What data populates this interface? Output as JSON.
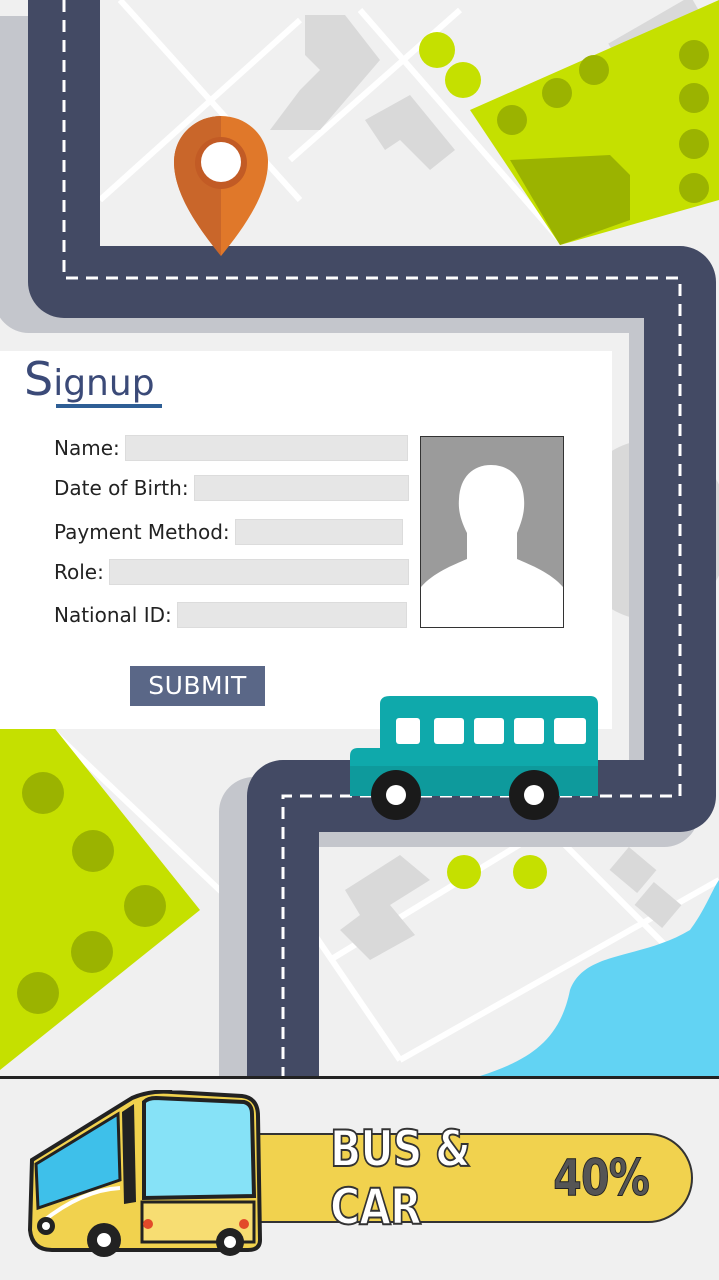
{
  "signup": {
    "title_first": "S",
    "title_rest": "ignup",
    "fields": [
      {
        "label": "Name:",
        "value": ""
      },
      {
        "label": "Date of Birth:",
        "value": ""
      },
      {
        "label": "Payment Method:",
        "value": ""
      },
      {
        "label": "Role:",
        "value": ""
      },
      {
        "label": "National ID:",
        "value": ""
      }
    ],
    "submit_label": "SUBMIT"
  },
  "promo": {
    "text": "BUS & CAR",
    "percent": "40%"
  },
  "colors": {
    "road": "#434a64",
    "lime": "#c5e000",
    "pin": "#e0782a",
    "bus": "#0fa9ab",
    "water": "#62d3f3",
    "banner": "#f1d24e",
    "submit": "#5a6787"
  },
  "icons": [
    "location-pin-icon",
    "bus-icon",
    "profile-silhouette-icon",
    "big-bus-icon"
  ]
}
